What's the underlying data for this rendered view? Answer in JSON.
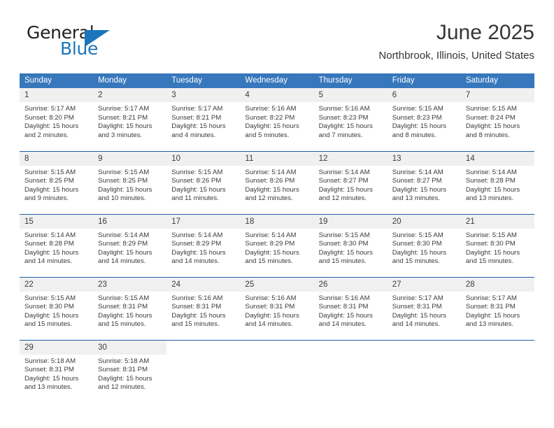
{
  "brand": {
    "name_part1": "General",
    "name_part2": "Blue",
    "triangle_icon": "triangle-logo-icon",
    "accent_color": "#1b76bc"
  },
  "header": {
    "month_title": "June 2025",
    "location": "Northbrook, Illinois, United States"
  },
  "theme": {
    "header_bg": "#3777bc",
    "row_divider": "#1f5fa8",
    "daynum_bg": "#f0f0f0",
    "text": "#3b3b3b"
  },
  "weekday_headers": [
    "Sunday",
    "Monday",
    "Tuesday",
    "Wednesday",
    "Thursday",
    "Friday",
    "Saturday"
  ],
  "weeks": [
    [
      {
        "day": "1",
        "sunrise": "Sunrise: 5:17 AM",
        "sunset": "Sunset: 8:20 PM",
        "daylight": "Daylight: 15 hours and 2 minutes."
      },
      {
        "day": "2",
        "sunrise": "Sunrise: 5:17 AM",
        "sunset": "Sunset: 8:21 PM",
        "daylight": "Daylight: 15 hours and 3 minutes."
      },
      {
        "day": "3",
        "sunrise": "Sunrise: 5:17 AM",
        "sunset": "Sunset: 8:21 PM",
        "daylight": "Daylight: 15 hours and 4 minutes."
      },
      {
        "day": "4",
        "sunrise": "Sunrise: 5:16 AM",
        "sunset": "Sunset: 8:22 PM",
        "daylight": "Daylight: 15 hours and 5 minutes."
      },
      {
        "day": "5",
        "sunrise": "Sunrise: 5:16 AM",
        "sunset": "Sunset: 8:23 PM",
        "daylight": "Daylight: 15 hours and 7 minutes."
      },
      {
        "day": "6",
        "sunrise": "Sunrise: 5:15 AM",
        "sunset": "Sunset: 8:23 PM",
        "daylight": "Daylight: 15 hours and 8 minutes."
      },
      {
        "day": "7",
        "sunrise": "Sunrise: 5:15 AM",
        "sunset": "Sunset: 8:24 PM",
        "daylight": "Daylight: 15 hours and 8 minutes."
      }
    ],
    [
      {
        "day": "8",
        "sunrise": "Sunrise: 5:15 AM",
        "sunset": "Sunset: 8:25 PM",
        "daylight": "Daylight: 15 hours and 9 minutes."
      },
      {
        "day": "9",
        "sunrise": "Sunrise: 5:15 AM",
        "sunset": "Sunset: 8:25 PM",
        "daylight": "Daylight: 15 hours and 10 minutes."
      },
      {
        "day": "10",
        "sunrise": "Sunrise: 5:15 AM",
        "sunset": "Sunset: 8:26 PM",
        "daylight": "Daylight: 15 hours and 11 minutes."
      },
      {
        "day": "11",
        "sunrise": "Sunrise: 5:14 AM",
        "sunset": "Sunset: 8:26 PM",
        "daylight": "Daylight: 15 hours and 12 minutes."
      },
      {
        "day": "12",
        "sunrise": "Sunrise: 5:14 AM",
        "sunset": "Sunset: 8:27 PM",
        "daylight": "Daylight: 15 hours and 12 minutes."
      },
      {
        "day": "13",
        "sunrise": "Sunrise: 5:14 AM",
        "sunset": "Sunset: 8:27 PM",
        "daylight": "Daylight: 15 hours and 13 minutes."
      },
      {
        "day": "14",
        "sunrise": "Sunrise: 5:14 AM",
        "sunset": "Sunset: 8:28 PM",
        "daylight": "Daylight: 15 hours and 13 minutes."
      }
    ],
    [
      {
        "day": "15",
        "sunrise": "Sunrise: 5:14 AM",
        "sunset": "Sunset: 8:28 PM",
        "daylight": "Daylight: 15 hours and 14 minutes."
      },
      {
        "day": "16",
        "sunrise": "Sunrise: 5:14 AM",
        "sunset": "Sunset: 8:29 PM",
        "daylight": "Daylight: 15 hours and 14 minutes."
      },
      {
        "day": "17",
        "sunrise": "Sunrise: 5:14 AM",
        "sunset": "Sunset: 8:29 PM",
        "daylight": "Daylight: 15 hours and 14 minutes."
      },
      {
        "day": "18",
        "sunrise": "Sunrise: 5:14 AM",
        "sunset": "Sunset: 8:29 PM",
        "daylight": "Daylight: 15 hours and 15 minutes."
      },
      {
        "day": "19",
        "sunrise": "Sunrise: 5:15 AM",
        "sunset": "Sunset: 8:30 PM",
        "daylight": "Daylight: 15 hours and 15 minutes."
      },
      {
        "day": "20",
        "sunrise": "Sunrise: 5:15 AM",
        "sunset": "Sunset: 8:30 PM",
        "daylight": "Daylight: 15 hours and 15 minutes."
      },
      {
        "day": "21",
        "sunrise": "Sunrise: 5:15 AM",
        "sunset": "Sunset: 8:30 PM",
        "daylight": "Daylight: 15 hours and 15 minutes."
      }
    ],
    [
      {
        "day": "22",
        "sunrise": "Sunrise: 5:15 AM",
        "sunset": "Sunset: 8:30 PM",
        "daylight": "Daylight: 15 hours and 15 minutes."
      },
      {
        "day": "23",
        "sunrise": "Sunrise: 5:15 AM",
        "sunset": "Sunset: 8:31 PM",
        "daylight": "Daylight: 15 hours and 15 minutes."
      },
      {
        "day": "24",
        "sunrise": "Sunrise: 5:16 AM",
        "sunset": "Sunset: 8:31 PM",
        "daylight": "Daylight: 15 hours and 15 minutes."
      },
      {
        "day": "25",
        "sunrise": "Sunrise: 5:16 AM",
        "sunset": "Sunset: 8:31 PM",
        "daylight": "Daylight: 15 hours and 14 minutes."
      },
      {
        "day": "26",
        "sunrise": "Sunrise: 5:16 AM",
        "sunset": "Sunset: 8:31 PM",
        "daylight": "Daylight: 15 hours and 14 minutes."
      },
      {
        "day": "27",
        "sunrise": "Sunrise: 5:17 AM",
        "sunset": "Sunset: 8:31 PM",
        "daylight": "Daylight: 15 hours and 14 minutes."
      },
      {
        "day": "28",
        "sunrise": "Sunrise: 5:17 AM",
        "sunset": "Sunset: 8:31 PM",
        "daylight": "Daylight: 15 hours and 13 minutes."
      }
    ],
    [
      {
        "day": "29",
        "sunrise": "Sunrise: 5:18 AM",
        "sunset": "Sunset: 8:31 PM",
        "daylight": "Daylight: 15 hours and 13 minutes."
      },
      {
        "day": "30",
        "sunrise": "Sunrise: 5:18 AM",
        "sunset": "Sunset: 8:31 PM",
        "daylight": "Daylight: 15 hours and 12 minutes."
      },
      {
        "day": "",
        "sunrise": "",
        "sunset": "",
        "daylight": ""
      },
      {
        "day": "",
        "sunrise": "",
        "sunset": "",
        "daylight": ""
      },
      {
        "day": "",
        "sunrise": "",
        "sunset": "",
        "daylight": ""
      },
      {
        "day": "",
        "sunrise": "",
        "sunset": "",
        "daylight": ""
      },
      {
        "day": "",
        "sunrise": "",
        "sunset": "",
        "daylight": ""
      }
    ]
  ]
}
